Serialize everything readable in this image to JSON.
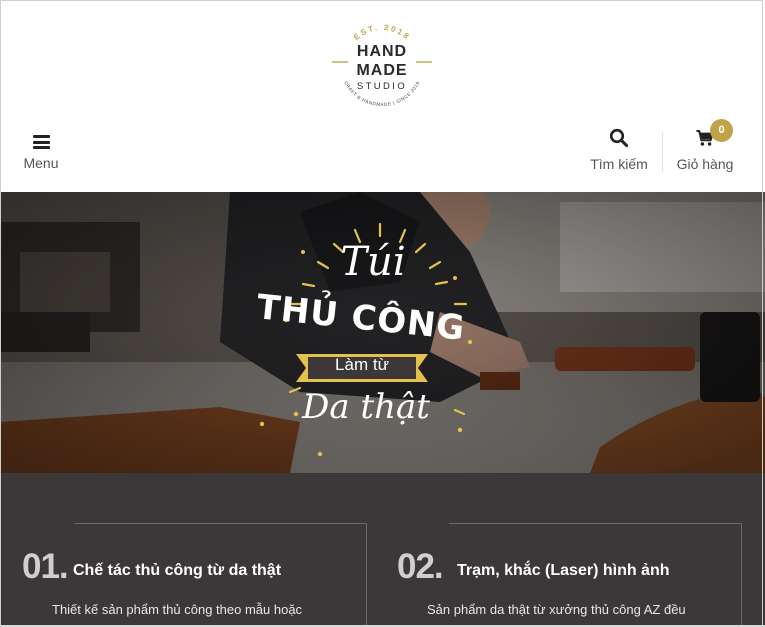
{
  "logo": {
    "est": "EST. 2018",
    "line1": "HAND",
    "line2": "MADE",
    "line3": "STUDIO",
    "tagline": "CRAFT & HANDMADE | SINCE 2018",
    "accent_color": "#c2a34a"
  },
  "header": {
    "menu_icon": "hamburger-icon",
    "menu_label": "Menu",
    "search_icon": "magnifier-icon",
    "search_label": "Tìm kiếm",
    "cart_icon": "cart-icon",
    "cart_label": "Giỏ hàng",
    "cart_count": "0",
    "badge_color": "#c2a34a"
  },
  "hero": {
    "line1": "Túi",
    "line2": "THỦ CÔNG",
    "line3": "Làm từ",
    "line4": "Da thật"
  },
  "features": [
    {
      "number": "01.",
      "title": "Chế tác thủ công từ da thật",
      "description": "Thiết kế sản phẩm thủ công theo mẫu hoặc"
    },
    {
      "number": "02.",
      "title": "Trạm, khắc (Laser) hình ảnh",
      "description": "Sản phẩm da thật từ xưởng thủ công AZ đều"
    }
  ],
  "colors": {
    "features_bg": "#3c3839",
    "accent": "#c2a34a"
  }
}
